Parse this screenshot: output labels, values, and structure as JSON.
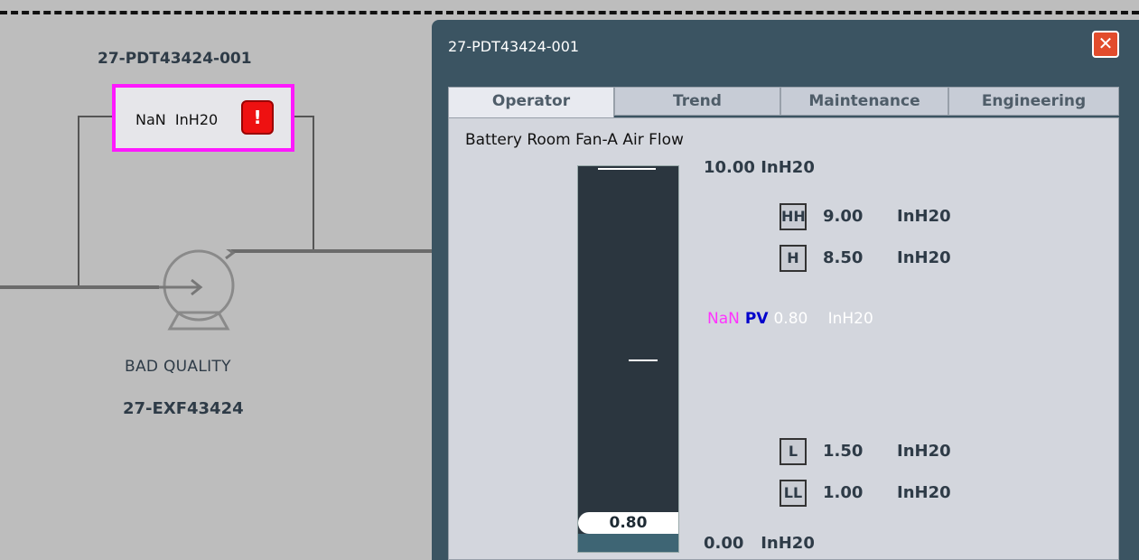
{
  "faceplate": {
    "tag": "27-PDT43424-001",
    "value": "NaN",
    "unit": "InH20",
    "alarm_icon": "alarm-exclamation-icon"
  },
  "equipment": {
    "status": "BAD QUALITY",
    "tag": "27-EXF43424",
    "icon": "pump-icon"
  },
  "dialog": {
    "title": "27-PDT43424-001",
    "close_icon": "close-icon",
    "tabs": [
      {
        "label": "Operator",
        "active": true
      },
      {
        "label": "Trend",
        "active": false
      },
      {
        "label": "Maintenance",
        "active": false
      },
      {
        "label": "Engineering",
        "active": false
      }
    ],
    "description": "Battery Room Fan-A Air Flow",
    "range_high": "10.00",
    "range_low": "0.00",
    "unit": "InH20",
    "bar_value": "0.80",
    "bar_fraction": 0.08,
    "sp_fraction": 0.5,
    "limits": {
      "hh": {
        "label": "HH",
        "value": "9.00",
        "unit": "InH20"
      },
      "h": {
        "label": "H",
        "value": "8.50",
        "unit": "InH20"
      },
      "l": {
        "label": "L",
        "value": "1.50",
        "unit": "InH20"
      },
      "ll": {
        "label": "LL",
        "value": "1.00",
        "unit": "InH20"
      }
    },
    "pv": {
      "nan": "NaN",
      "label": "PV",
      "value": "0.80",
      "unit": "InH20"
    },
    "colors": {
      "nan": "#ff33ff",
      "pv_label": "#0000cc",
      "pv_value": "#ffffff"
    }
  }
}
